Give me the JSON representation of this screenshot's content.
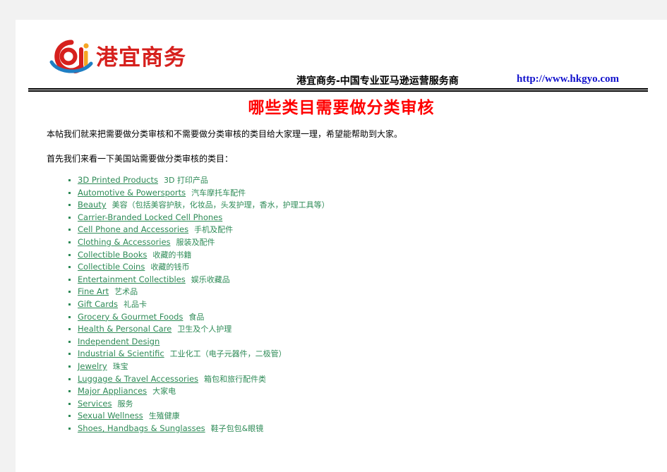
{
  "header": {
    "logo_text": "港宜商务",
    "logo_icon": "gyo-circle-logo",
    "tagline": "港宜商务-中国专业亚马逊运营服务商",
    "url": "http://www.hkgyo.com",
    "colors": {
      "logo_red": "#d6201d",
      "logo_orange": "#f5a623",
      "logo_blue": "#1f7fc4",
      "url_blue": "#1111cc",
      "title_red": "#ff0000",
      "list_green": "#2e8b57"
    }
  },
  "title": "哪些类目需要做分类审核",
  "paragraphs": [
    "本帖我们就来把需要做分类审核和不需要做分类审核的类目给大家理一理，希望能帮助到大家。",
    "首先我们来看一下美国站需要做分类审核的类目："
  ],
  "categories": [
    {
      "en": "3D Printed Products",
      "cn": "3D 打印产品"
    },
    {
      "en": "Automotive & Powersports",
      "cn": "汽车摩托车配件"
    },
    {
      "en": "Beauty",
      "cn": "美容（包括美容护肤，化妆品，头发护理，香水，护理工具等）"
    },
    {
      "en": "Carrier-Branded Locked Cell Phones",
      "cn": ""
    },
    {
      "en": "Cell Phone and Accessories",
      "cn": "手机及配件"
    },
    {
      "en": "Clothing & Accessories",
      "cn": "服装及配件"
    },
    {
      "en": "Collectible Books",
      "cn": "收藏的书籍"
    },
    {
      "en": "Collectible Coins",
      "cn": "收藏的钱币"
    },
    {
      "en": "Entertainment Collectibles",
      "cn": "娱乐收藏品"
    },
    {
      "en": "Fine Art",
      "cn": "艺术品"
    },
    {
      "en": "Gift Cards",
      "cn": "礼品卡"
    },
    {
      "en": "Grocery & Gourmet Foods",
      "cn": "食品"
    },
    {
      "en": "Health & Personal Care",
      "cn": "卫生及个人护理"
    },
    {
      "en": "Independent Design",
      "cn": ""
    },
    {
      "en": "Industrial & Scientific",
      "cn": "工业化工（电子元器件，二极管）"
    },
    {
      "en": "Jewelry",
      "cn": "珠宝"
    },
    {
      "en": "Luggage & Travel Accessories",
      "cn": "箱包和旅行配件类"
    },
    {
      "en": "Major Appliances",
      "cn": "大家电"
    },
    {
      "en": "Services",
      "cn": "服务"
    },
    {
      "en": "Sexual Wellness",
      "cn": "生殖健康"
    },
    {
      "en": "Shoes, Handbags & Sunglasses",
      "cn": "鞋子包包&眼镜"
    }
  ]
}
